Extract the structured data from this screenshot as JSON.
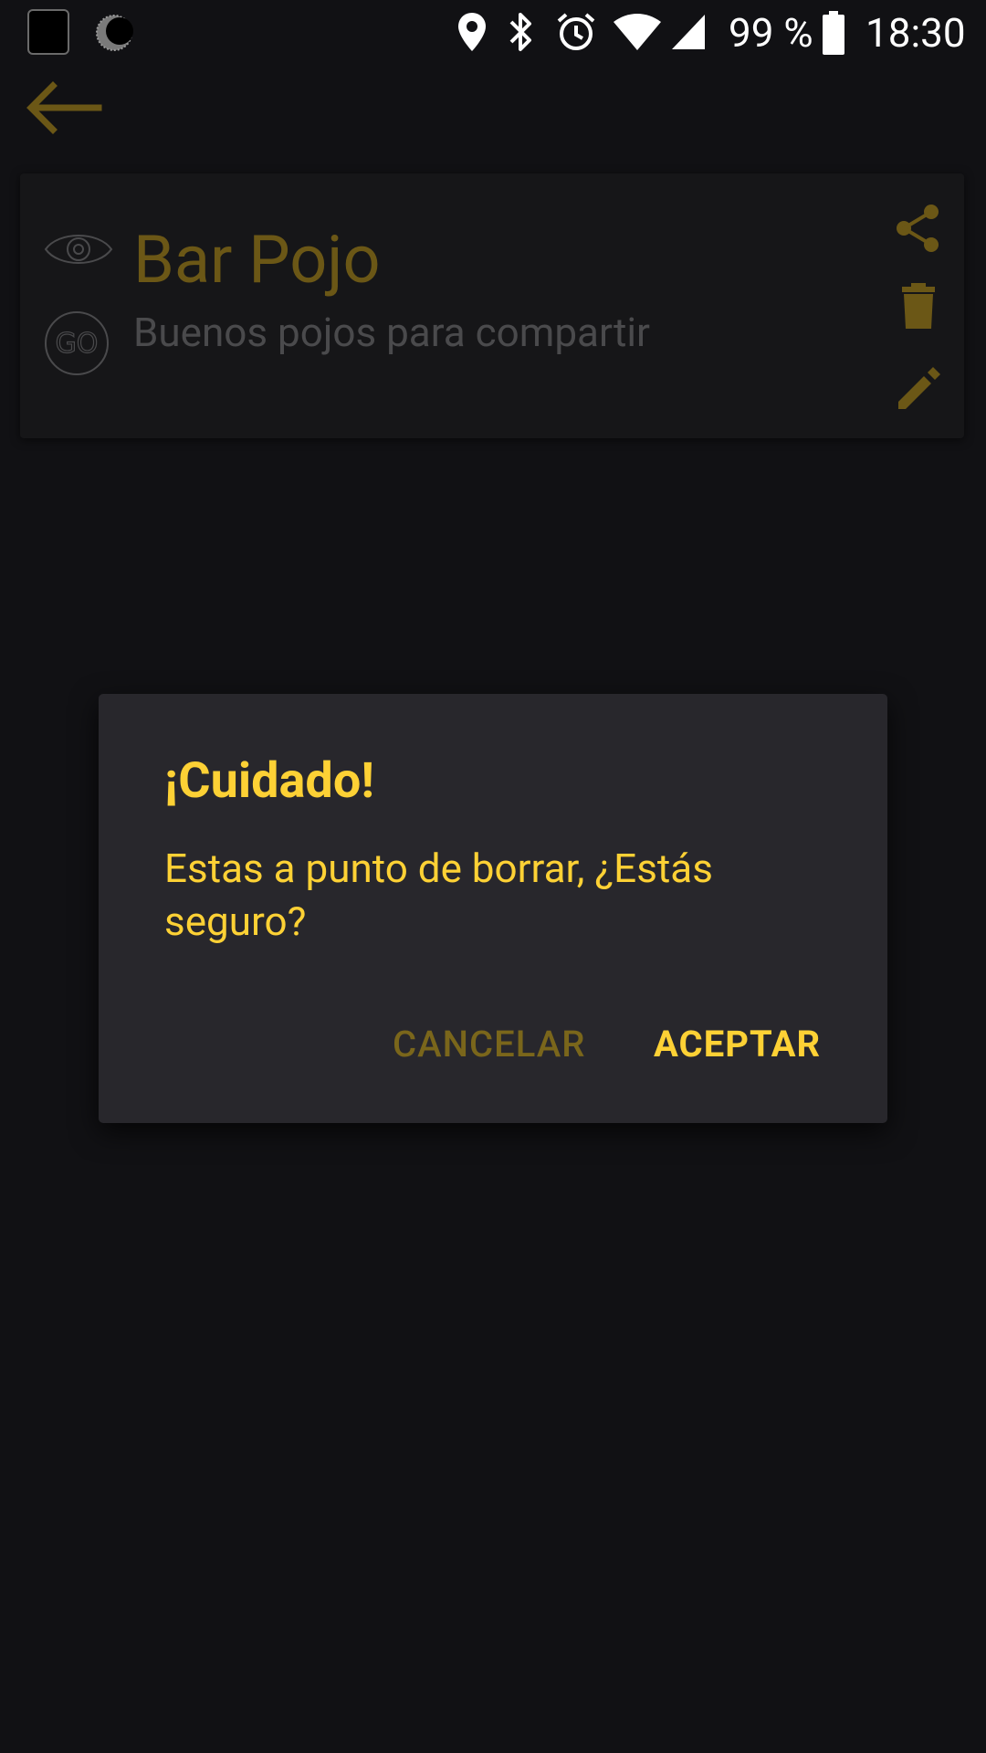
{
  "status_bar": {
    "battery_text": "99 %",
    "time": "18:30",
    "icons": [
      "notification-square-icon",
      "moon-icon",
      "location-icon",
      "bluetooth-icon",
      "alarm-icon",
      "wifi-icon",
      "cell-signal-icon",
      "battery-icon"
    ]
  },
  "app_bar": {
    "back_icon": "arrow-back-icon"
  },
  "card": {
    "title": "Bar Pojo",
    "subtitle": "Buenos pojos para compartir",
    "go_badge": "GO",
    "actions": [
      "share-icon",
      "delete-icon",
      "edit-icon"
    ]
  },
  "dialog": {
    "title": "¡Cuidado!",
    "message": "Estas a punto de borrar, ¿Estás seguro?",
    "cancel_label": "CANCELAR",
    "accept_label": "ACEPTAR"
  },
  "colors": {
    "accent": "#fdd135",
    "accent_dim": "#7a661b",
    "background": "#111114",
    "dialog_bg": "#28272c"
  }
}
